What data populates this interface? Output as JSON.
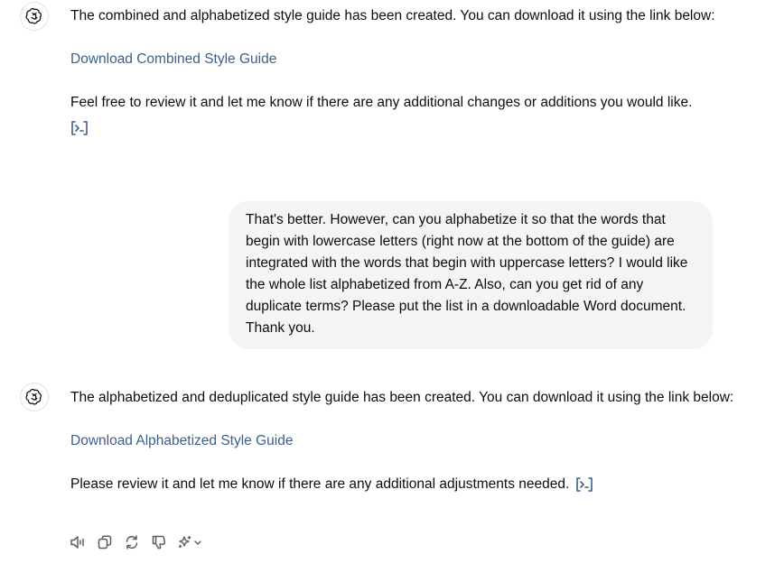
{
  "messages": {
    "assistant1": {
      "line1": "The combined and alphabetized style guide has been created. You can download it using the link below:",
      "link": "Download Combined Style Guide",
      "closing": "Feel free to review it and let me know if there are any additional changes or additions you would like."
    },
    "user1": {
      "text": "That's better. However, can you alphabetize it so that the words that begin with lowercase letters (right now at the bottom of the guide) are integrated with the words that begin with uppercase letters? I would like the whole list alphabetized from A-Z. Also, can you get rid of any duplicate terms? Please put the list in a downloadable Word document. Thank you."
    },
    "assistant2": {
      "line1": "The alphabetized and deduplicated style guide has been created. You can download it using the link below:",
      "link": "Download Alphabetized Style Guide",
      "closing": "Please review it and let me know if there are any additional adjustments needed."
    }
  },
  "icons": {
    "avatar": "openai-logo-icon",
    "code": "view-analysis-icon",
    "actions": [
      "read-aloud-icon",
      "copy-icon",
      "regenerate-icon",
      "thumbs-down-icon",
      "sparkle-model-icon",
      "chevron-down-icon"
    ]
  },
  "colors": {
    "link": "#3e5f8a",
    "bubble": "#f4f4f4",
    "text": "#0d0d0d",
    "icon": "#5d5d5d"
  }
}
